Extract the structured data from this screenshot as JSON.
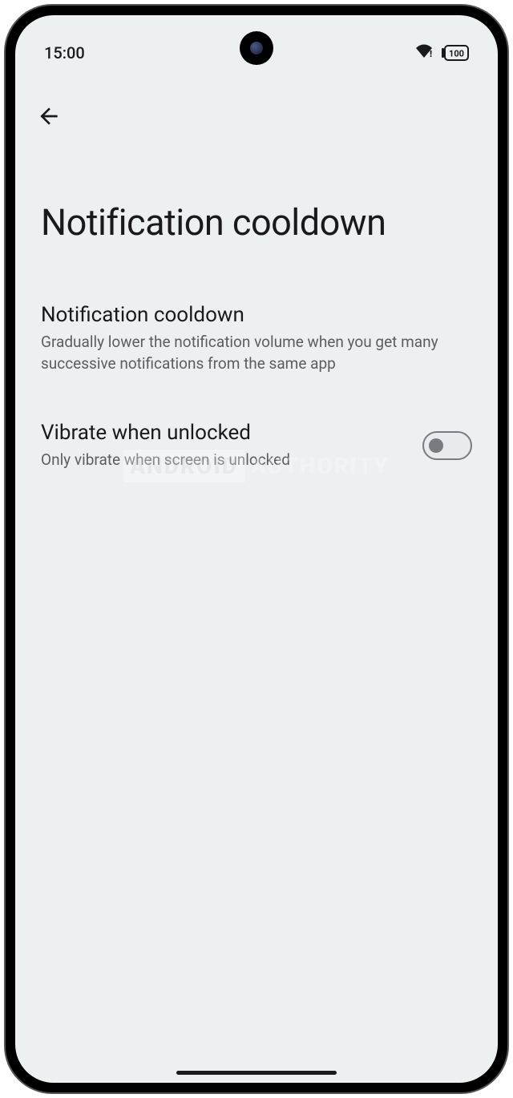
{
  "status_bar": {
    "time": "15:00",
    "battery_level": "100"
  },
  "page": {
    "title": "Notification cooldown"
  },
  "settings": [
    {
      "title": "Notification cooldown",
      "description": "Gradually lower the notification volume when you get many successive notifications from the same app"
    },
    {
      "title": "Vibrate when unlocked",
      "description": "Only vibrate when screen is unlocked",
      "toggle": false
    }
  ],
  "watermark": {
    "box": "ANDROID",
    "text": "AUTHORITY"
  }
}
